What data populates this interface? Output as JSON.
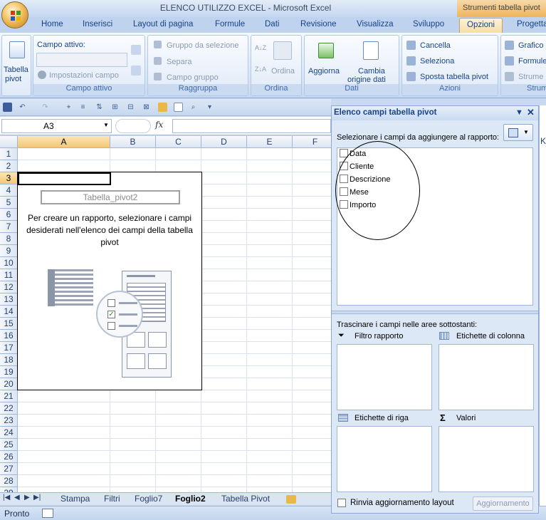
{
  "window": {
    "title": "ELENCO UTILIZZO EXCEL - Microsoft Excel",
    "context_tab_group": "Strumenti tabella pivot"
  },
  "tabs": [
    "Home",
    "Inserisci",
    "Layout di pagina",
    "Formule",
    "Dati",
    "Revisione",
    "Visualizza",
    "Sviluppo",
    "Opzioni",
    "Progetta"
  ],
  "ribbon": {
    "tabella_pivot": {
      "label": "Tabella",
      "label2": "pivot"
    },
    "campo_attivo": {
      "title": "Campo attivo:",
      "value": "",
      "impostazioni": "Impostazioni campo",
      "group": "Campo attivo"
    },
    "raggruppa": {
      "gruppo_selezione": "Gruppo da selezione",
      "separa": "Separa",
      "campo_gruppo": "Campo gruppo",
      "group": "Raggruppa"
    },
    "ordina": {
      "label": "Ordina",
      "group": "Ordina"
    },
    "dati": {
      "aggiorna": "Aggiorna",
      "cambia": "Cambia",
      "origine": "origine dati",
      "group": "Dati"
    },
    "azioni": {
      "cancella": "Cancella",
      "seleziona": "Seleziona",
      "sposta": "Sposta tabella pivot",
      "group": "Azioni"
    },
    "strumenti": {
      "grafico": "Grafico",
      "formule": "Formule",
      "strume": "Strume",
      "group": "Strum"
    }
  },
  "formula_bar": {
    "name_box": "A3",
    "fx": "fx",
    "content": ""
  },
  "grid": {
    "columns": [
      "A",
      "B",
      "C",
      "D",
      "E",
      "F"
    ],
    "rows": [
      "1",
      "2",
      "3",
      "4",
      "5",
      "6",
      "7",
      "8",
      "9",
      "10",
      "11",
      "12",
      "13",
      "14",
      "15",
      "16",
      "17",
      "18",
      "19",
      "20",
      "21",
      "22",
      "23",
      "24",
      "25",
      "26",
      "27",
      "28",
      "29"
    ],
    "selected_cell": "A3",
    "pivot_name": "Tabella_pivot2",
    "pivot_message": "Per creare un rapporto, selezionare i campi desiderati nell'elenco dei campi della tabella pivot"
  },
  "sheet_tabs": [
    "Stampa",
    "Filtri",
    "Foglio7",
    "Foglio2",
    "Tabella Pivot"
  ],
  "active_sheet": "Foglio2",
  "status": {
    "ready": "Pronto"
  },
  "pane": {
    "title": "Elenco campi tabella pivot",
    "select_prompt": "Selezionare i campi da aggiungere al rapporto:",
    "fields": [
      {
        "label": "Data",
        "checked": false
      },
      {
        "label": "Cliente",
        "checked": false
      },
      {
        "label": "Descrizione",
        "checked": false
      },
      {
        "label": "Mese",
        "checked": false
      },
      {
        "label": "Importo",
        "checked": false
      }
    ],
    "drag_prompt": "Trascinare i campi nelle aree sottostanti:",
    "areas": {
      "filtro": "Filtro rapporto",
      "colonna": "Etichette di colonna",
      "riga": "Etichette di riga",
      "valori": "Valori"
    },
    "defer_label": "Rinvia aggiornamento layout",
    "update_button": "Aggiornamento",
    "hidden_col": "K"
  },
  "colors": {
    "accent": "#15428b",
    "ribbon_bg": "#dbe7f6",
    "context": "#f0b55b"
  }
}
